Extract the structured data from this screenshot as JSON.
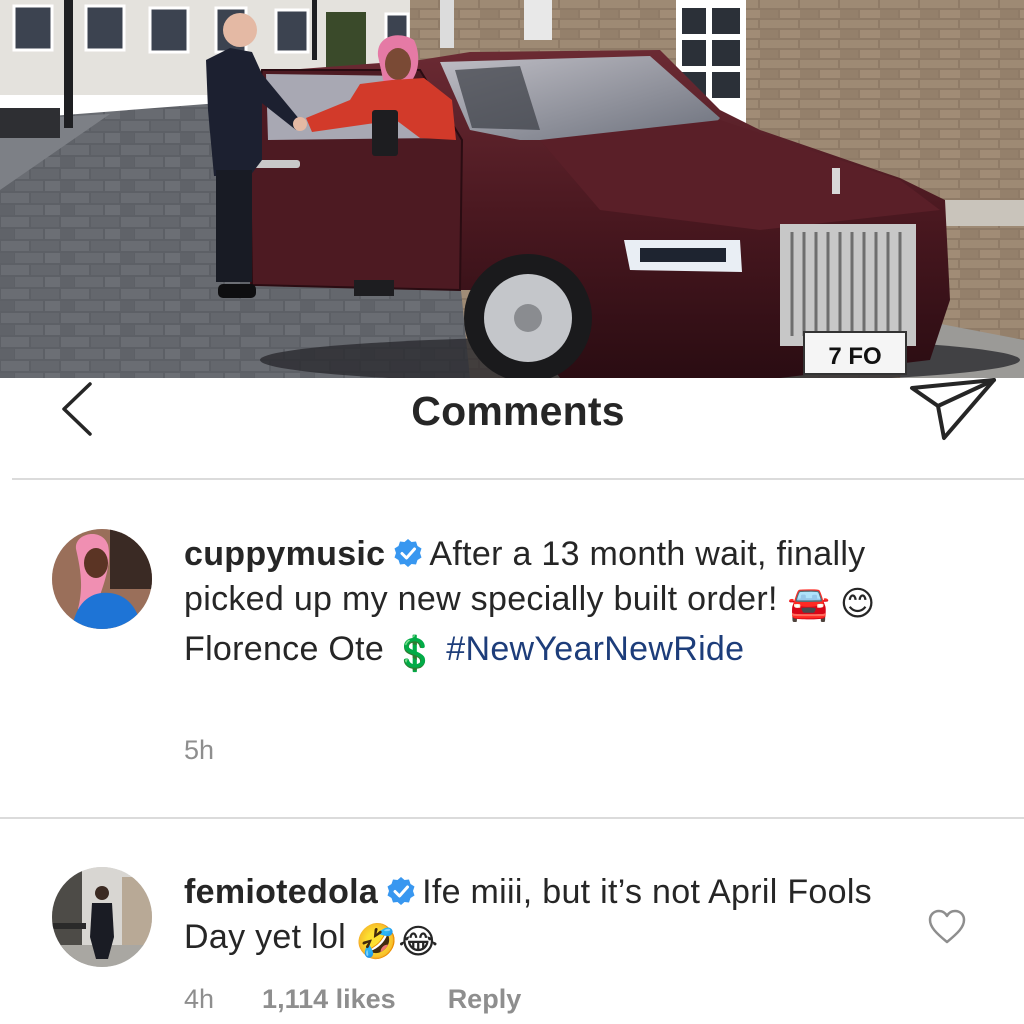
{
  "photo": {
    "license_plate": "7 FO"
  },
  "header": {
    "title": "Comments",
    "back_icon": "chevron-left-icon",
    "share_icon": "direct-share-icon"
  },
  "comments": [
    {
      "username": "cuppymusic",
      "verified": true,
      "text_main": "After a 13 month wait, finally picked up my new specially built order!",
      "emoji_1": "🚘",
      "emoji_2": "😊",
      "text_after_emoji": "Florence Ote",
      "symbol": "💲",
      "hashtag": "#NewYearNewRide",
      "time": "5h"
    },
    {
      "username": "femiotedola",
      "verified": true,
      "text_main": "Ife miii, but it’s not April Fools Day yet lol",
      "emoji_1": "🤣",
      "emoji_2": "😂",
      "time": "4h",
      "likes": "1,114 likes",
      "reply": "Reply",
      "like_icon": "heart-outline-icon"
    }
  ],
  "colors": {
    "text": "#262626",
    "muted": "#8e8e8e",
    "verified_blue": "#3897f0",
    "hashtag": "#1d3d7a",
    "divider": "#dbdbdb",
    "car_body": "#4a1820"
  }
}
